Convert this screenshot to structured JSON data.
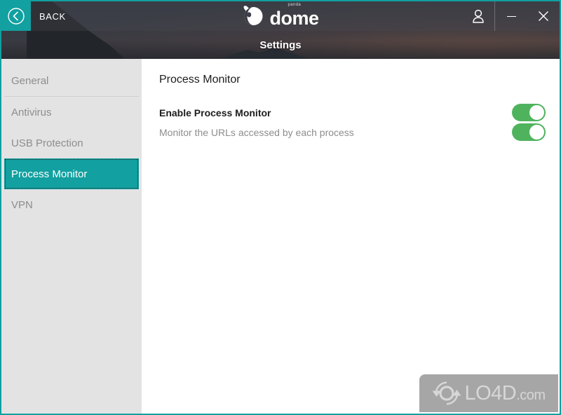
{
  "window": {
    "accent_color": "#12a0a0",
    "back_label": "BACK",
    "back_icon": "chevron-left-circle-icon",
    "account_icon": "user-account-icon",
    "minimize_label": "–",
    "close_label": "✕",
    "brand": {
      "mark": "panda-logo-icon",
      "superscript": "panda",
      "name": "dome"
    }
  },
  "subheader": {
    "title": "Settings"
  },
  "sidebar": {
    "items": [
      {
        "label": "General",
        "active": false,
        "divider_below": true
      },
      {
        "label": "Antivirus",
        "active": false,
        "divider_below": false
      },
      {
        "label": "USB Protection",
        "active": false,
        "divider_below": false
      },
      {
        "label": "Process Monitor",
        "active": true,
        "divider_below": false
      },
      {
        "label": "VPN",
        "active": false,
        "divider_below": false
      }
    ]
  },
  "content": {
    "panel_title": "Process Monitor",
    "settings": [
      {
        "label": "Enable Process Monitor",
        "style": "strong",
        "toggle_state": "on",
        "toggle_color": "#4fb35e"
      },
      {
        "label": "Monitor the URLs accessed by each process",
        "style": "muted",
        "toggle_state": "on",
        "toggle_color": "#4fb35e"
      }
    ]
  },
  "watermark": {
    "icon": "circular-arrows-icon",
    "name": "LO4D",
    "suffix": ".com"
  }
}
